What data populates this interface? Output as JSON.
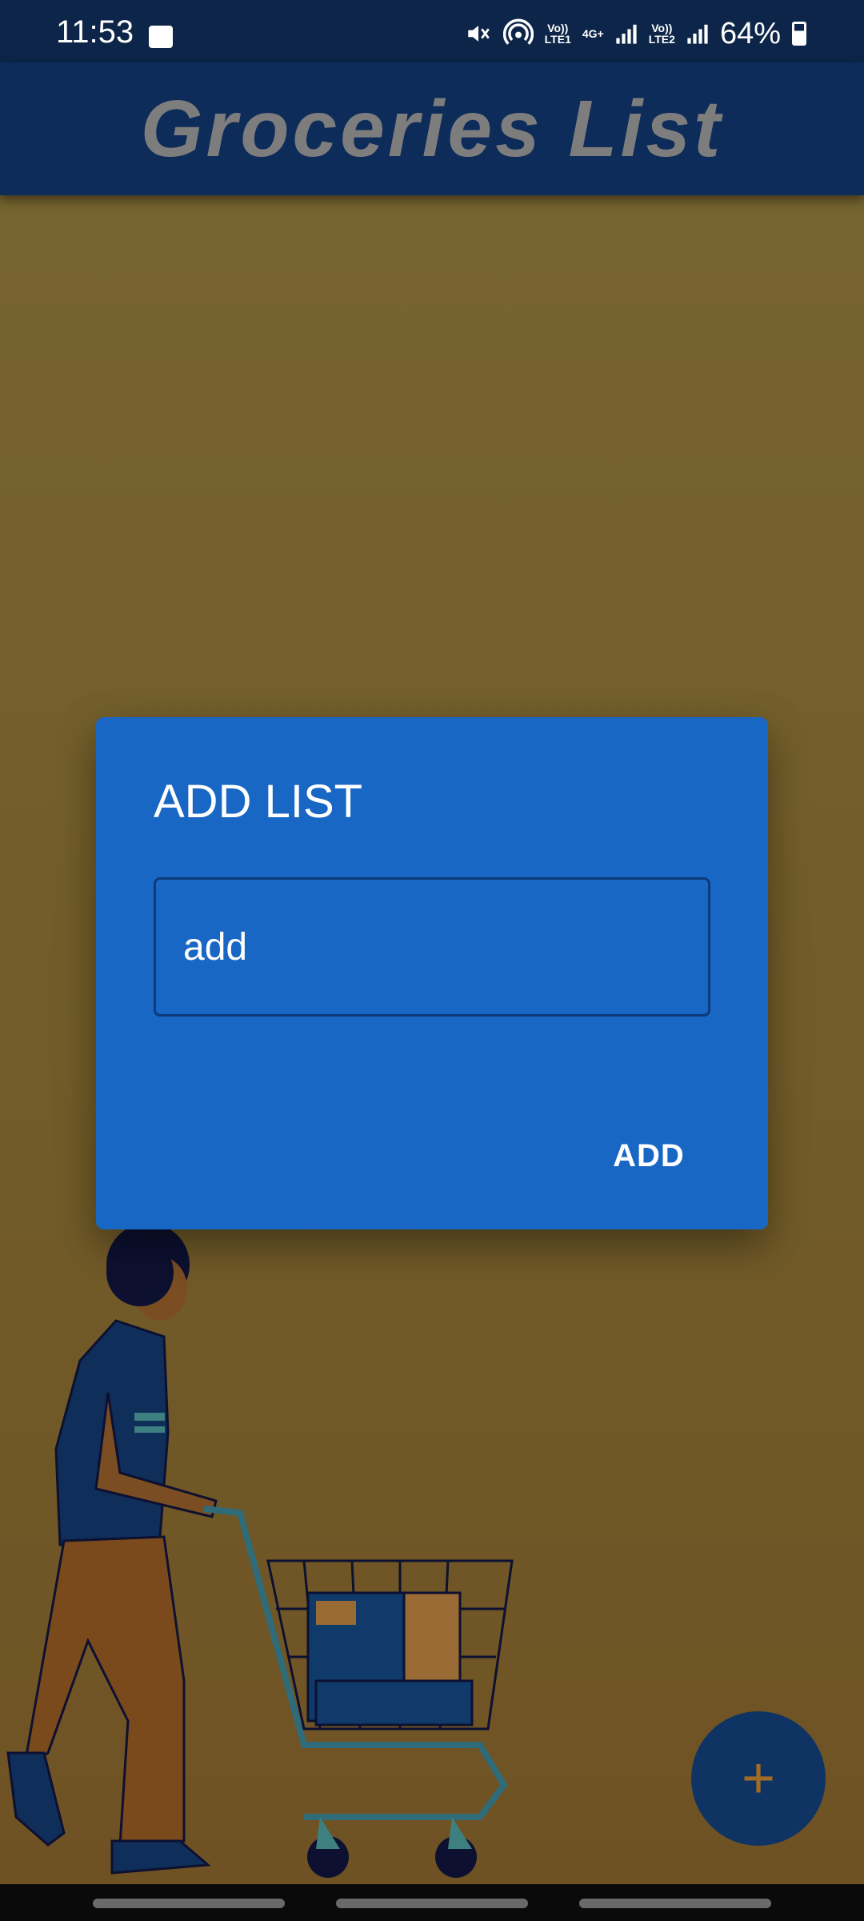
{
  "status_bar": {
    "time": "11:53",
    "lte1": "Vo))\nLTE1",
    "net": "4G+",
    "lte2": "Vo))\nLTE2",
    "battery": "64%",
    "battery_level": 0.64
  },
  "app_bar": {
    "title": "Groceries List"
  },
  "dialog": {
    "title": "ADD LIST",
    "input_value": "add",
    "button_label": "ADD"
  },
  "fab": {
    "icon": "plus-icon",
    "glyph": "+"
  },
  "colors": {
    "app_bar": "#0e2c5a",
    "dialog": "#1967c4",
    "title_text": "#7d7d7d",
    "background": "#76642f",
    "fab": "#0f3363"
  }
}
